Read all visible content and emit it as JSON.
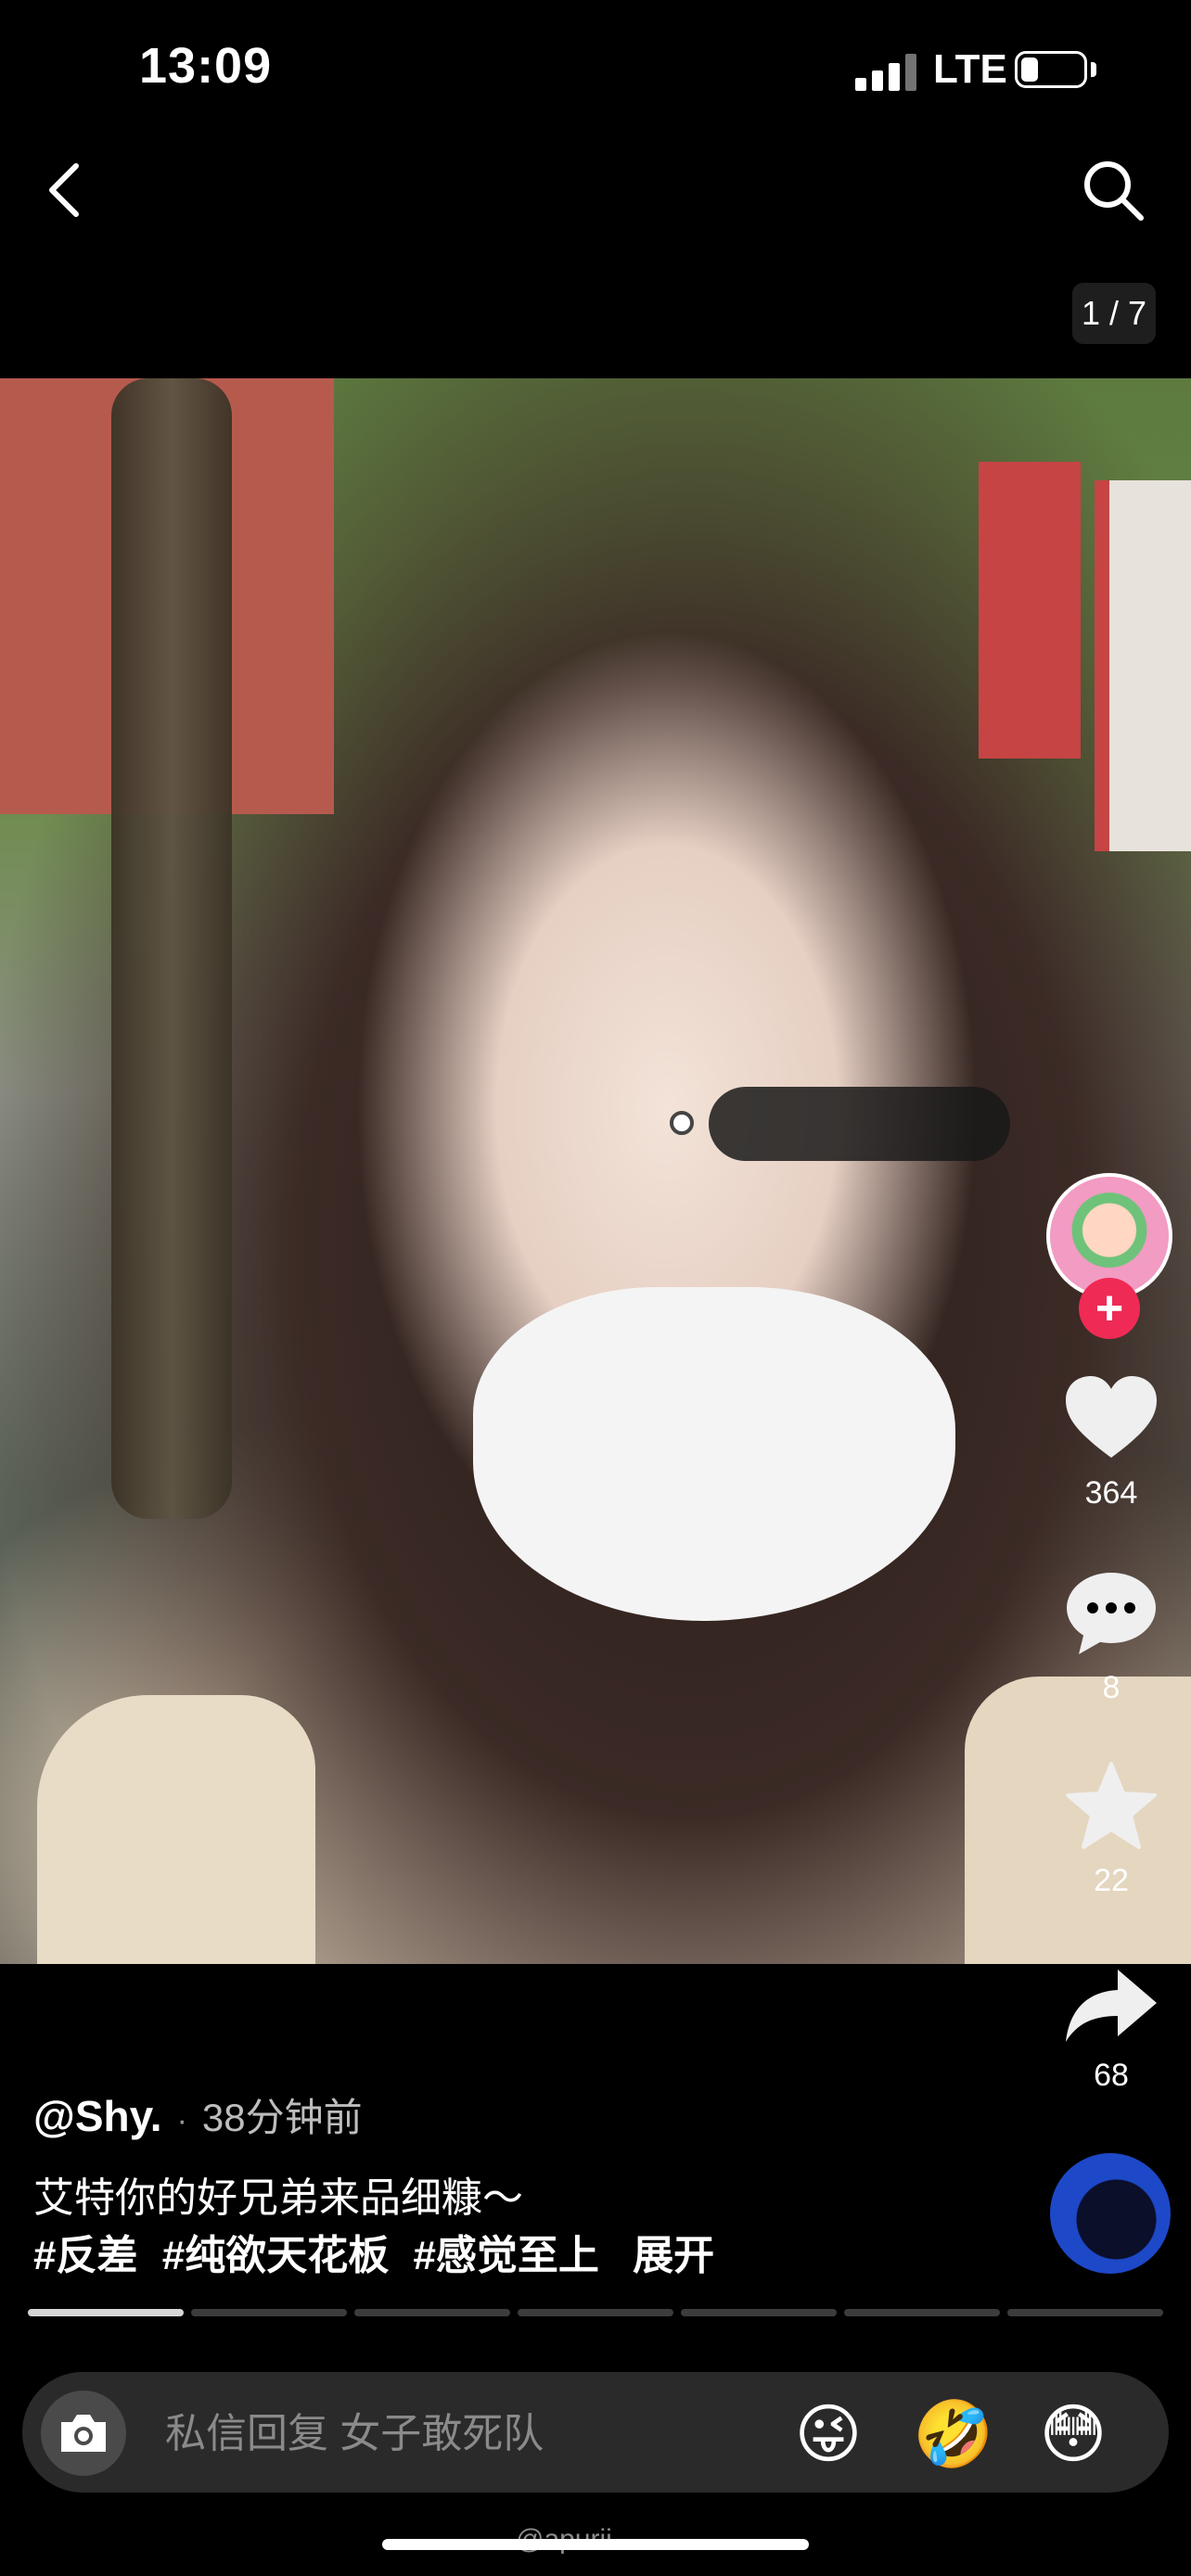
{
  "status_bar": {
    "time": "13:09",
    "network": "LTE"
  },
  "nav": {
    "back_icon": "chevron-left-icon",
    "search_icon": "search-icon",
    "image_counter": "1 / 7"
  },
  "actions": {
    "likes": "364",
    "comments": "8",
    "favorites": "22",
    "shares": "68"
  },
  "post": {
    "author": "@Shy.",
    "separator": "·",
    "time_ago": "38分钟前",
    "caption": "艾特你的好兄弟来品细糠～",
    "hashtags": [
      "#反差",
      "#纯欲天花板",
      "#感觉至上"
    ],
    "expand_label": "展开"
  },
  "gallery": {
    "total_images": 7,
    "current_index": 1
  },
  "reply": {
    "placeholder": "私信回复 女子敢死队",
    "emojis": [
      "😜",
      "🤣",
      "😳"
    ]
  },
  "watermark": "@apurii",
  "colors": {
    "accent_red": "#ef2a55",
    "background": "#000000"
  }
}
